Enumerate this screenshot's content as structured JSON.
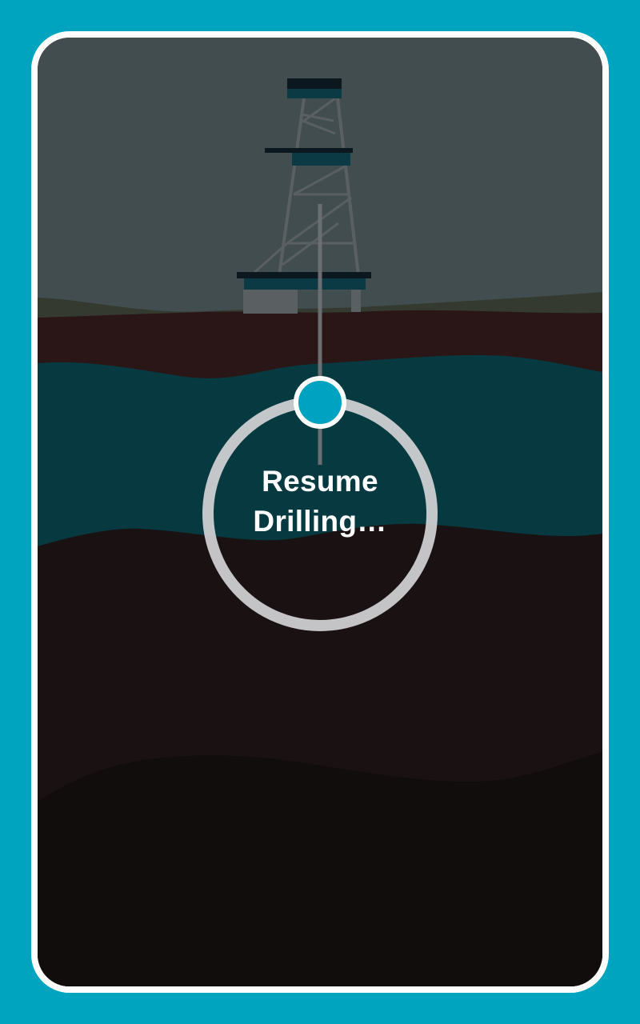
{
  "colors": {
    "background": "#00a4bf",
    "frame": "#ffffff",
    "sky": "#424d50",
    "topsoil": "#2a1616",
    "teal_layer": "#063a40",
    "deep_rock": "#1a1113",
    "bedrock": "#120d0d",
    "drill_head": "#00a2c2",
    "ring": "#d2d2d4"
  },
  "overlay": {
    "state": "paused",
    "resume_label_line1": "Resume",
    "resume_label_line2": "Drilling…"
  },
  "icons": {
    "drill_head": "circle-icon",
    "derrick": "oil-derrick-icon"
  }
}
